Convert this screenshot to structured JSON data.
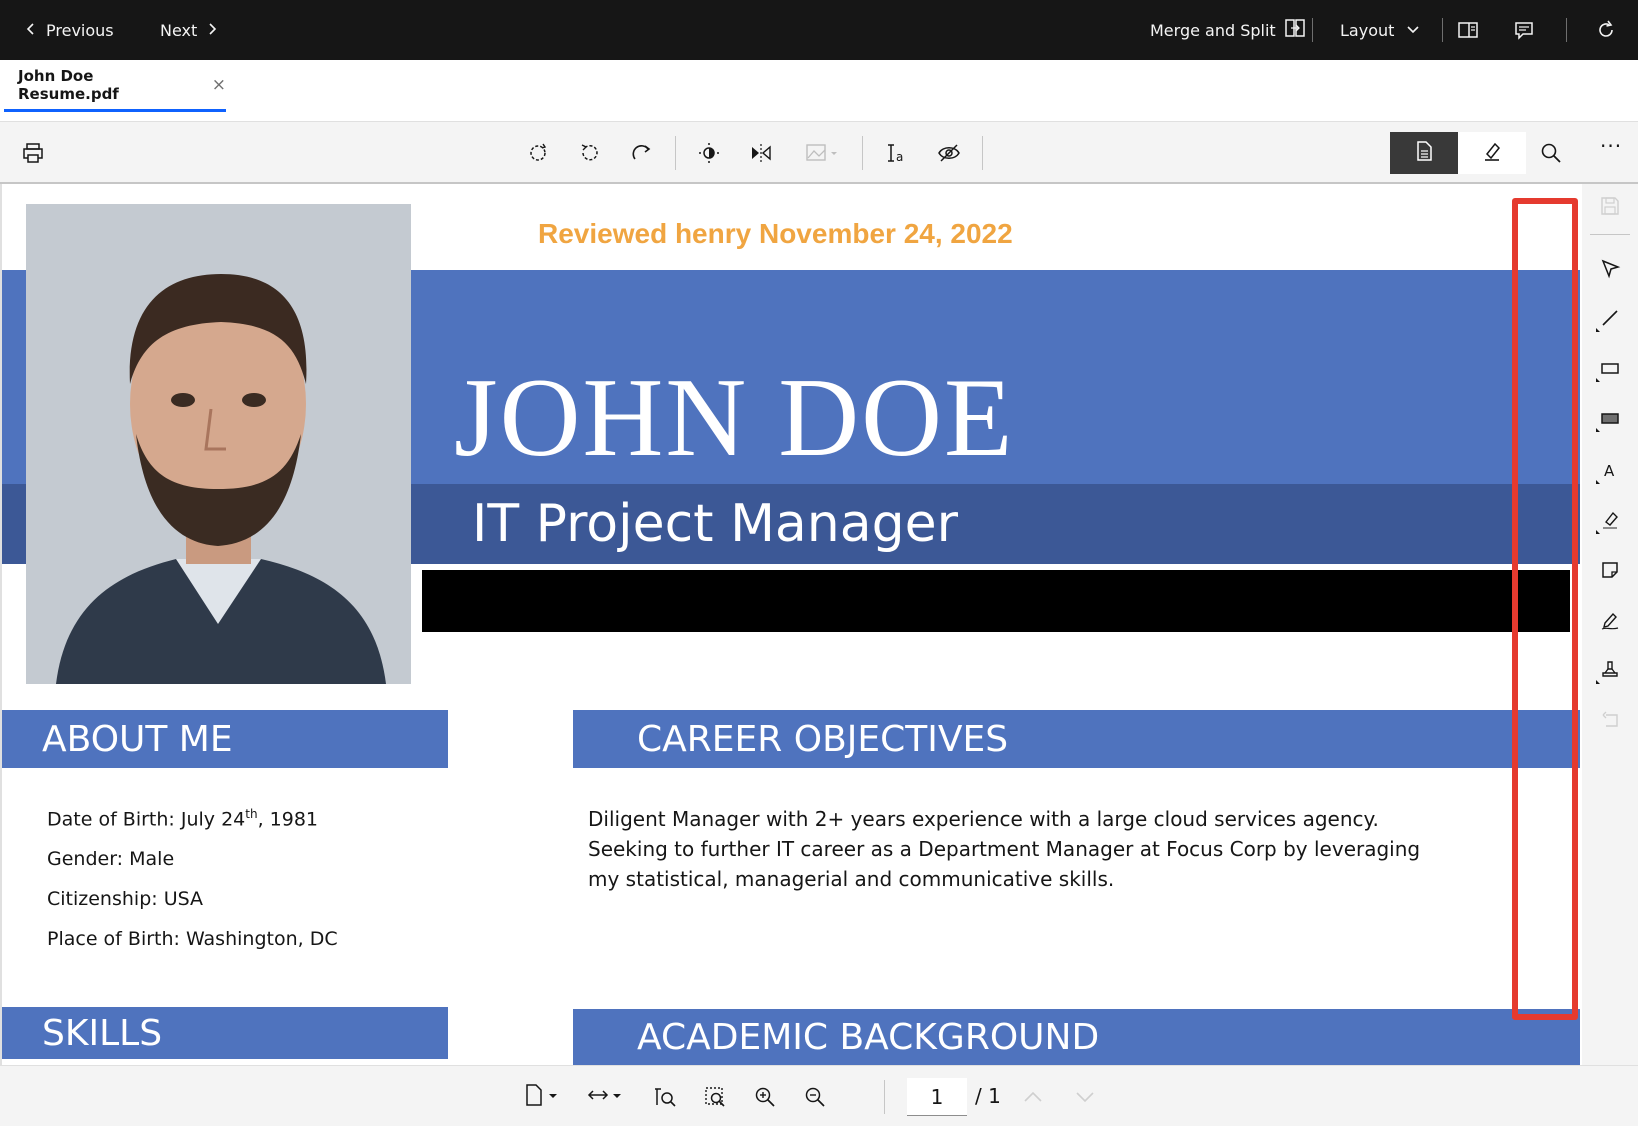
{
  "topbar": {
    "previous_label": "Previous",
    "next_label": "Next",
    "merge_split_label": "Merge and Split",
    "layout_label": "Layout"
  },
  "tab": {
    "filename": "John Doe Resume.pdf",
    "close_symbol": "×"
  },
  "toolbar": {
    "icons": [
      "print-icon",
      "rotate-icon",
      "rotate-left-icon",
      "rotate-right-icon",
      "brightness-icon",
      "flip-icon",
      "image-icon",
      "text-recognition-icon",
      "hide-icon",
      "view-mode-icon",
      "annotate-mode-icon",
      "search-icon",
      "more-icon"
    ],
    "more_label": "···"
  },
  "document": {
    "reviewed_stamp": "Reviewed henry November 24, 2022",
    "name": "JOHN DOE",
    "role": "IT Project Manager",
    "about_heading": "ABOUT ME",
    "about_items": {
      "dob_prefix": "Date of Birth: July 24",
      "dob_sup": "th",
      "dob_suffix": ", 1981",
      "gender": "Gender: Male",
      "citizenship": "Citizenship: USA",
      "place_of_birth": "Place of Birth: Washington, DC"
    },
    "career_heading": "CAREER OBJECTIVES",
    "career_text": "Diligent Manager with 2+ years experience with a large cloud services agency. Seeking to further IT career as a Department Manager at Focus Corp  by leveraging my statistical, managerial and communicative skills.",
    "skills_heading": "SKILLS",
    "academic_heading": "ACADEMIC BACKGROUND",
    "colors": {
      "banner": "#4f73be",
      "banner_dark": "#3c5896",
      "stamp": "#f0a541",
      "highlight": "#e53a2f"
    }
  },
  "annotation_panel": {
    "icons": [
      "save-icon",
      "select-icon",
      "line-icon",
      "rectangle-icon",
      "filled-rectangle-icon",
      "text-icon",
      "highlighter-icon",
      "sticky-note-icon",
      "signature-icon",
      "stamp-icon",
      "undo-icon"
    ]
  },
  "bottombar": {
    "current_page": "1",
    "total_pages": "/ 1"
  }
}
